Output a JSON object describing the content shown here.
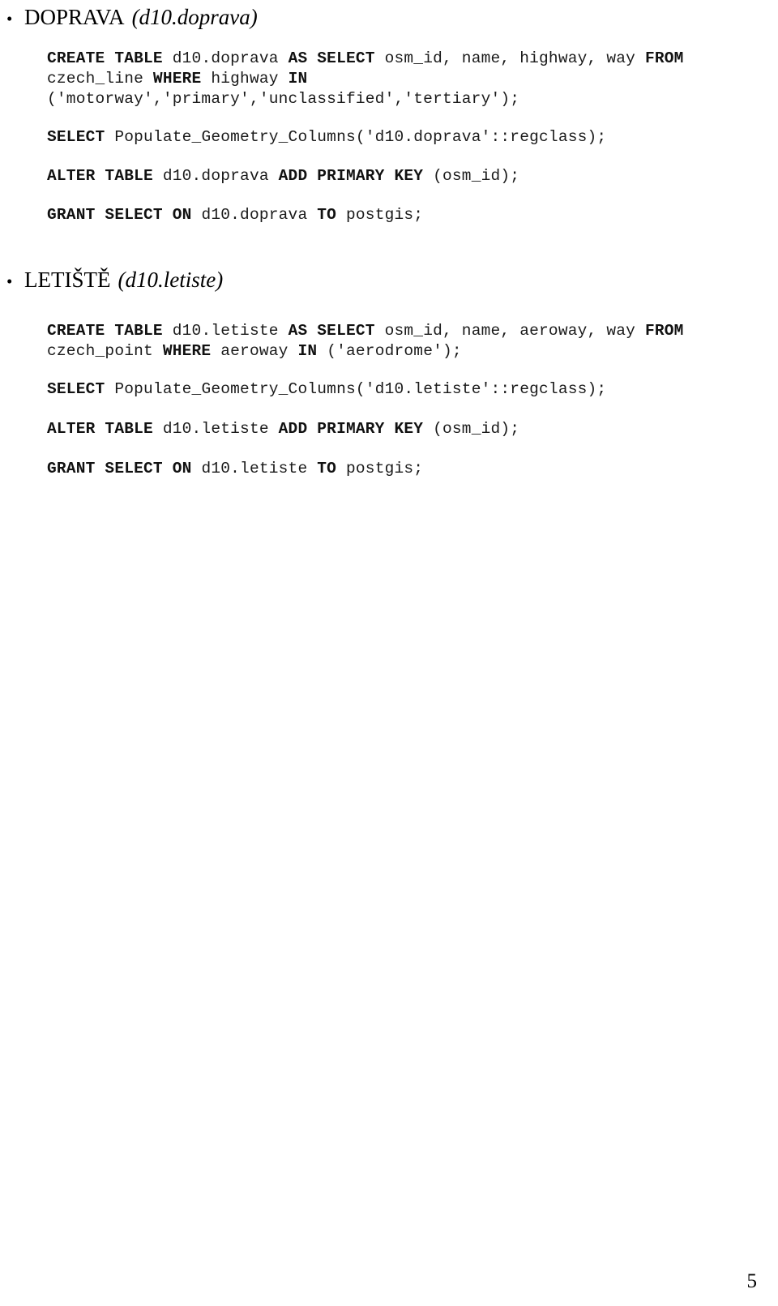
{
  "document": {
    "page_number": "5",
    "bullet_glyph": "•"
  },
  "sections": [
    {
      "id": "doprava",
      "heading": {
        "title": "DOPRAVA",
        "reference": "(d10.doprava)"
      },
      "code_lines": [
        [
          {
            "t": "CREATE TABLE ",
            "b": true
          },
          {
            "t": "d10.doprava ",
            "b": false
          },
          {
            "t": "AS SELECT ",
            "b": true
          },
          {
            "t": "osm_id, name, highway, way ",
            "b": false
          },
          {
            "t": "FROM",
            "b": true
          }
        ],
        [
          {
            "t": "czech_line ",
            "b": false
          },
          {
            "t": "WHERE ",
            "b": true
          },
          {
            "t": "highway ",
            "b": false
          },
          {
            "t": "IN",
            "b": true
          }
        ],
        [
          {
            "t": "('motorway','primary','unclassified','tertiary');",
            "b": false
          }
        ],
        [
          {
            "t": "SELECT ",
            "b": true
          },
          {
            "t": "Populate_Geometry_Columns('d10.doprava'::regclass);",
            "b": false
          }
        ],
        [
          {
            "t": "ALTER TABLE ",
            "b": true
          },
          {
            "t": "d10.doprava ",
            "b": false
          },
          {
            "t": "ADD PRIMARY KEY ",
            "b": true
          },
          {
            "t": "(osm_id);",
            "b": false
          }
        ],
        [
          {
            "t": "GRANT SELECT ON ",
            "b": true
          },
          {
            "t": "d10.doprava ",
            "b": false
          },
          {
            "t": "TO ",
            "b": true
          },
          {
            "t": "postgis;",
            "b": false
          }
        ]
      ]
    },
    {
      "id": "letiste",
      "heading": {
        "title": "LETIŠTĚ",
        "reference": "(d10.letiste)"
      },
      "code_lines": [
        [
          {
            "t": "CREATE TABLE ",
            "b": true
          },
          {
            "t": "d10.letiste ",
            "b": false
          },
          {
            "t": "AS SELECT ",
            "b": true
          },
          {
            "t": "osm_id, name, aeroway, way ",
            "b": false
          },
          {
            "t": "FROM",
            "b": true
          }
        ],
        [
          {
            "t": "czech_point ",
            "b": false
          },
          {
            "t": "WHERE ",
            "b": true
          },
          {
            "t": "aeroway ",
            "b": false
          },
          {
            "t": "IN ",
            "b": true
          },
          {
            "t": "('aerodrome');",
            "b": false
          }
        ],
        [
          {
            "t": "SELECT ",
            "b": true
          },
          {
            "t": "Populate_Geometry_Columns('d10.letiste'::regclass);",
            "b": false
          }
        ],
        [
          {
            "t": "ALTER TABLE ",
            "b": true
          },
          {
            "t": "d10.letiste ",
            "b": false
          },
          {
            "t": "ADD PRIMARY KEY ",
            "b": true
          },
          {
            "t": "(osm_id);",
            "b": false
          }
        ],
        [
          {
            "t": "GRANT SELECT ON ",
            "b": true
          },
          {
            "t": "d10.letiste ",
            "b": false
          },
          {
            "t": "TO ",
            "b": true
          },
          {
            "t": "postgis;",
            "b": false
          }
        ]
      ]
    }
  ],
  "layout": {
    "section_tops": [
      8,
      332
    ],
    "line_tops": [
      [
        60,
        85,
        110,
        157,
        205,
        253
      ],
      [
        396,
        421,
        468,
        517,
        566
      ]
    ]
  }
}
